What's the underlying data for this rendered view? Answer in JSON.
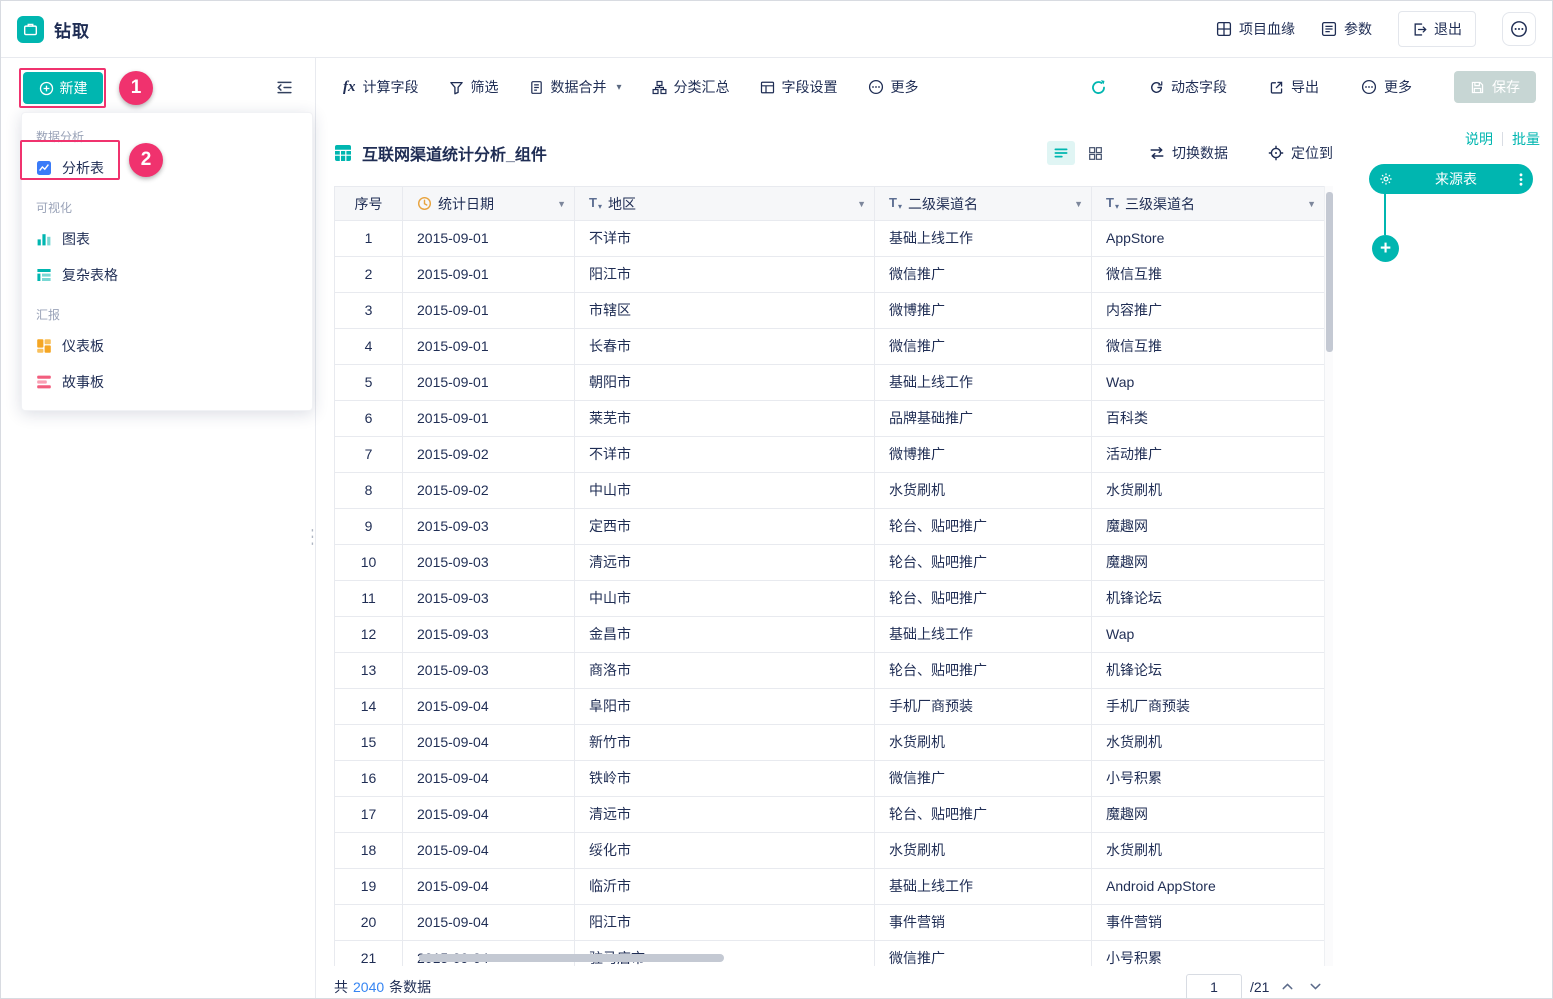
{
  "annotations": {
    "step1": "1",
    "step2": "2"
  },
  "header": {
    "title": "钻取",
    "project_lineage": "项目血缘",
    "params": "参数",
    "exit": "退出"
  },
  "sidebar": {
    "new_button": "新建",
    "menu": {
      "section_data_analysis": "数据分析",
      "analysis_table": "分析表",
      "section_visualization": "可视化",
      "chart": "图表",
      "complex_table": "复杂表格",
      "section_report": "汇报",
      "dashboard": "仪表板",
      "storyboard": "故事板"
    }
  },
  "toolbar": {
    "fx": "fx",
    "calc_field": "计算字段",
    "filter": "筛选",
    "data_merge": "数据合并",
    "category_summary": "分类汇总",
    "field_settings": "字段设置",
    "more_left": "更多",
    "dynamic_field": "动态字段",
    "export": "导出",
    "more_right": "更多",
    "save": "保存"
  },
  "content": {
    "table_title": "互联网渠道统计分析_组件",
    "switch_data": "切换数据",
    "locate_to": "定位到"
  },
  "right_panel": {
    "note": "说明",
    "batch": "批量",
    "source_table": "来源表"
  },
  "table": {
    "columns": [
      "序号",
      "统计日期",
      "地区",
      "二级渠道名",
      "三级渠道名"
    ],
    "rows": [
      [
        "1",
        "2015-09-01",
        "不详市",
        "基础上线工作",
        "AppStore"
      ],
      [
        "2",
        "2015-09-01",
        "阳江市",
        "微信推广",
        "微信互推"
      ],
      [
        "3",
        "2015-09-01",
        "市辖区",
        "微博推广",
        "内容推广"
      ],
      [
        "4",
        "2015-09-01",
        "长春市",
        "微信推广",
        "微信互推"
      ],
      [
        "5",
        "2015-09-01",
        "朝阳市",
        "基础上线工作",
        "Wap"
      ],
      [
        "6",
        "2015-09-01",
        "莱芜市",
        "品牌基础推广",
        "百科类"
      ],
      [
        "7",
        "2015-09-02",
        "不详市",
        "微博推广",
        "活动推广"
      ],
      [
        "8",
        "2015-09-02",
        "中山市",
        "水货刷机",
        "水货刷机"
      ],
      [
        "9",
        "2015-09-03",
        "定西市",
        "轮台、贴吧推广",
        "魔趣网"
      ],
      [
        "10",
        "2015-09-03",
        "清远市",
        "轮台、贴吧推广",
        "魔趣网"
      ],
      [
        "11",
        "2015-09-03",
        "中山市",
        "轮台、贴吧推广",
        "机锋论坛"
      ],
      [
        "12",
        "2015-09-03",
        "金昌市",
        "基础上线工作",
        "Wap"
      ],
      [
        "13",
        "2015-09-03",
        "商洛市",
        "轮台、贴吧推广",
        "机锋论坛"
      ],
      [
        "14",
        "2015-09-04",
        "阜阳市",
        "手机厂商预装",
        "手机厂商预装"
      ],
      [
        "15",
        "2015-09-04",
        "新竹市",
        "水货刷机",
        "水货刷机"
      ],
      [
        "16",
        "2015-09-04",
        "铁岭市",
        "微信推广",
        "小号积累"
      ],
      [
        "17",
        "2015-09-04",
        "清远市",
        "轮台、贴吧推广",
        "魔趣网"
      ],
      [
        "18",
        "2015-09-04",
        "绥化市",
        "水货刷机",
        "水货刷机"
      ],
      [
        "19",
        "2015-09-04",
        "临沂市",
        "基础上线工作",
        "Android AppStore"
      ],
      [
        "20",
        "2015-09-04",
        "阳江市",
        "事件营销",
        "事件营销"
      ],
      [
        "21",
        "2015-09-04",
        "驻马店市",
        "微信推广",
        "小号积累"
      ]
    ]
  },
  "footer": {
    "total_prefix": "共",
    "total_count": "2040",
    "total_suffix": "条数据",
    "page_value": "1",
    "page_total": "/21"
  },
  "colors": {
    "accent": "#00b6b0",
    "annotation": "#f0326e",
    "count_link": "#3685f2",
    "save_disabled": "#c7d6d4"
  }
}
